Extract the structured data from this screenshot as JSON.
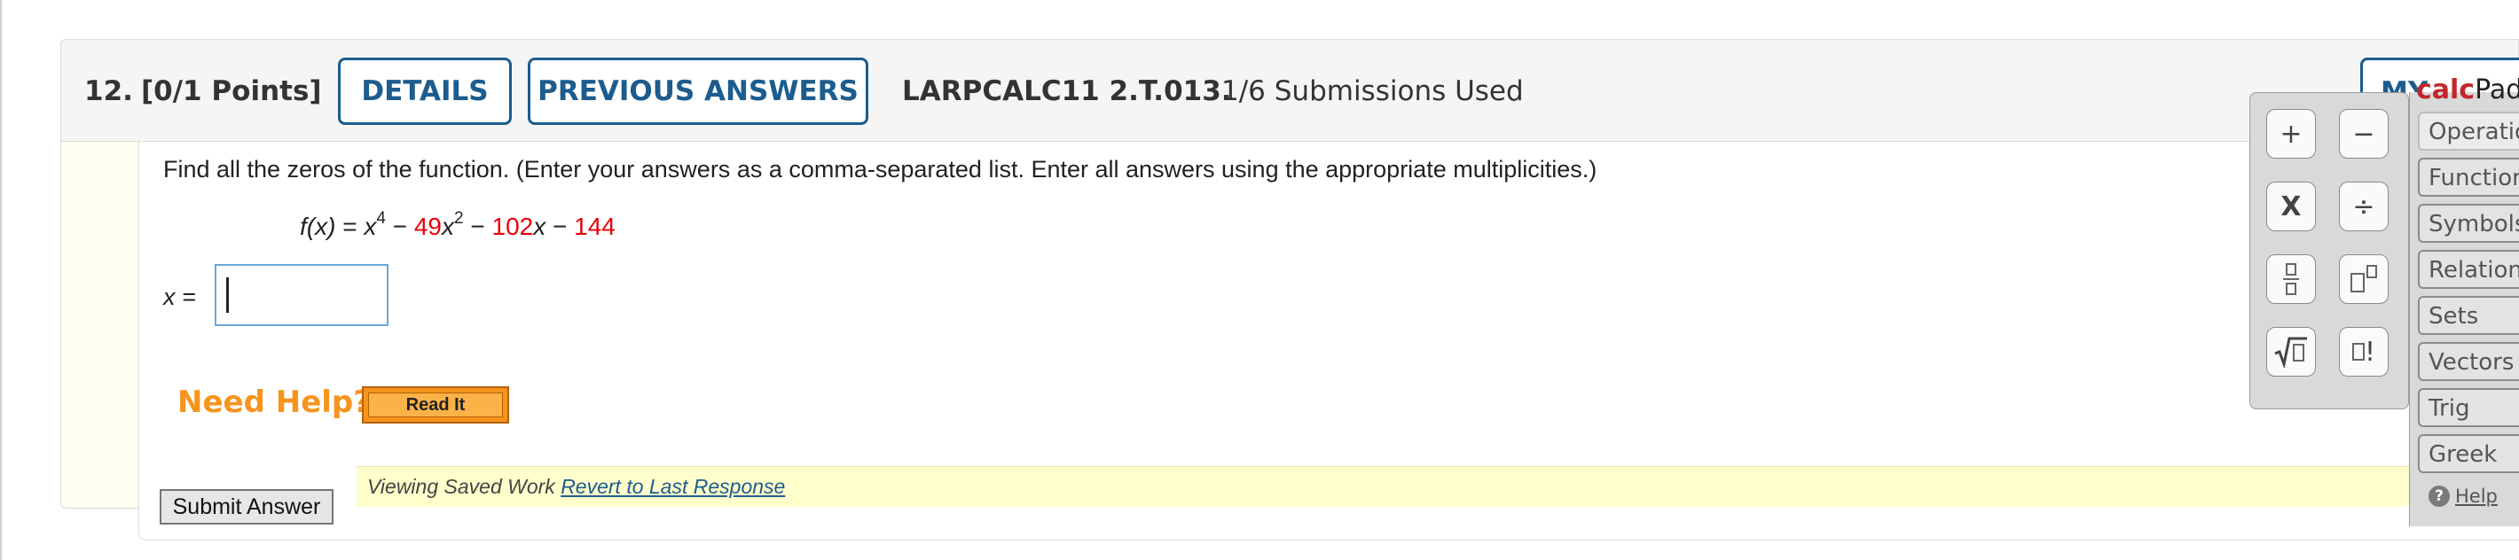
{
  "header": {
    "question_number": "12.",
    "points": "[0/1 Points]",
    "details_label": "DETAILS",
    "previous_answers_label": "PREVIOUS ANSWERS",
    "problem_code": "LARPCALC11 2.T.013.",
    "submissions": "1/6 Submissions Used",
    "my_notes_label": "MY NOTES"
  },
  "question": {
    "prompt": "Find all the zeros of the function. (Enter your answers as a comma-separated list. Enter all answers using the appropriate multiplicities.)",
    "function": {
      "lhs": "f(x)",
      "equals": " = ",
      "x_term": "x",
      "x_exp": "4",
      "minus1": " − ",
      "coef2": "49",
      "x2_term": "x",
      "x2_exp": "2",
      "minus2": " − ",
      "coef1": "102",
      "x1_term": "x",
      "minus3": " − ",
      "const": "144"
    },
    "answer_label": "x  =",
    "answer_value": "",
    "accent_red": "#e8000b"
  },
  "help": {
    "need_help": "Need Help?",
    "read_it": "Read It"
  },
  "saved_work": {
    "viewing": "Viewing Saved Work ",
    "revert": "Revert to Last Response"
  },
  "submit_label": "Submit Answer",
  "calcpad": {
    "title_calc": "calc",
    "title_pad": "Pad",
    "buttons": {
      "plus": "+",
      "minus": "−",
      "times": "X",
      "divide": "÷",
      "factorial": "!"
    },
    "categories": [
      "Operations",
      "Functions",
      "Symbols",
      "Relations",
      "Sets",
      "Vectors",
      "Trig",
      "Greek"
    ],
    "help": "Help",
    "brand_red": "#c0272d"
  }
}
